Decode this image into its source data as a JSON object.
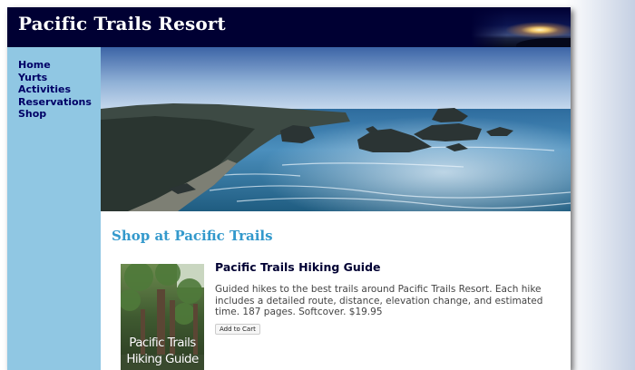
{
  "site": {
    "title": "Pacific Trails Resort"
  },
  "nav": {
    "items": [
      {
        "label": "Home"
      },
      {
        "label": "Yurts"
      },
      {
        "label": "Activities"
      },
      {
        "label": "Reservations"
      },
      {
        "label": "Shop"
      }
    ]
  },
  "main": {
    "heading": "Shop at Pacific Trails",
    "product": {
      "name": "Pacific Trails Hiking Guide",
      "description": "Guided hikes to the best trails around Pacific Trails Resort. Each hike includes a detailed route, distance, elevation change, and estimated time. 187 pages. Softcover. $19.95",
      "button_label": "Add to Cart",
      "cover_text_line1": "Pacific Trails",
      "cover_text_line2": "Hiking Guide"
    }
  },
  "colors": {
    "header_bg": "#000033",
    "nav_bg": "#90c7e3",
    "nav_link": "#000066",
    "heading": "#3399cc",
    "product_name": "#000033"
  }
}
